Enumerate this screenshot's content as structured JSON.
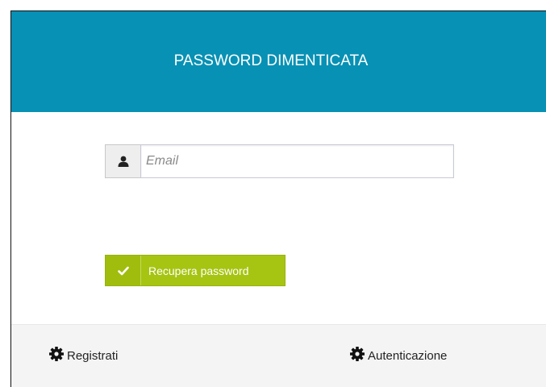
{
  "header": {
    "title": "PASSWORD DIMENTICATA"
  },
  "form": {
    "email": {
      "icon": "user-icon",
      "placeholder": "Email",
      "value": ""
    },
    "submit": {
      "icon": "check-icon",
      "label": "Recupera password"
    }
  },
  "footer": {
    "register": {
      "icon": "gear-icon",
      "label": "Registrati"
    },
    "login": {
      "icon": "gear-icon",
      "label": "Autenticazione"
    }
  },
  "colors": {
    "header_bg": "#0791b5",
    "button_green": "#a6c412"
  }
}
